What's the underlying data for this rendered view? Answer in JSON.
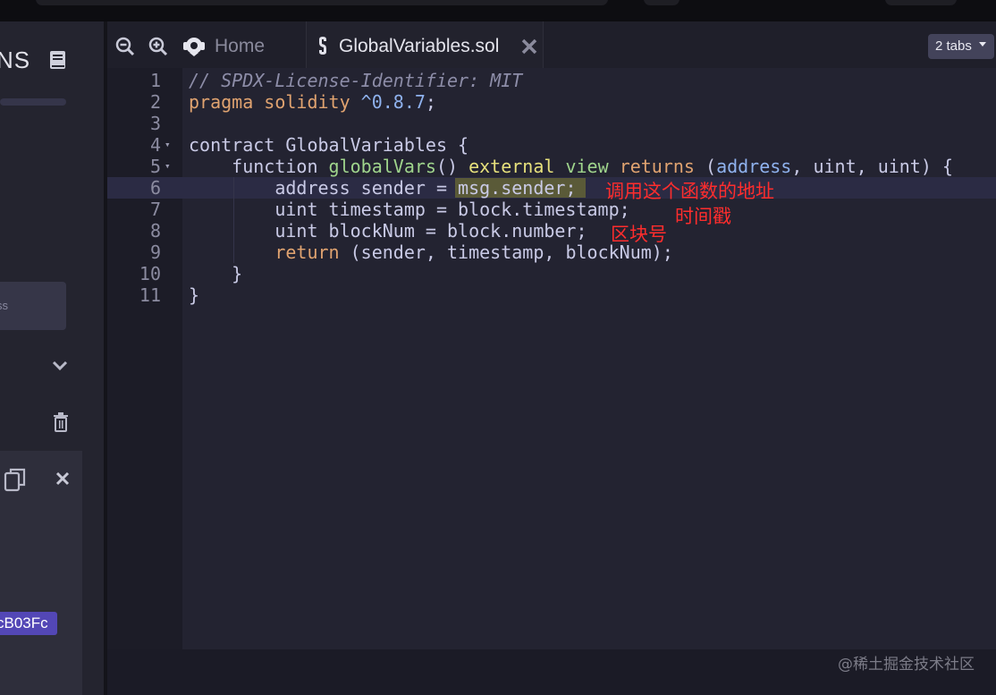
{
  "left_panel": {
    "title": "NS",
    "input_placeholder": "ss",
    "address_badge": "cB03Fc",
    "icons": [
      "book-icon",
      "chevron-down-icon",
      "trash-icon",
      "copy-icon",
      "close-icon"
    ]
  },
  "tabbar": {
    "home_label": "Home",
    "file_tab_label": "GlobalVariables.sol",
    "tabs_dropdown": "2 tabs",
    "icons": [
      "zoom-out-icon",
      "zoom-in-icon",
      "remix-logo-icon",
      "solidity-icon",
      "close-icon",
      "caret-down-icon"
    ]
  },
  "editor": {
    "lines": [
      {
        "n": "1",
        "fold": "",
        "tokens": [
          {
            "t": "// SPDX-License-Identifier: MIT",
            "c": "#8d8da8",
            "i": true
          }
        ]
      },
      {
        "n": "2",
        "fold": "",
        "tokens": [
          {
            "t": "pragma solidity ",
            "c": "#e0a370"
          },
          {
            "t": "^0.8.7",
            "c": "#8fb2ee"
          },
          {
            "t": ";",
            "c": "#c9cae6"
          }
        ]
      },
      {
        "n": "3",
        "fold": "",
        "tokens": []
      },
      {
        "n": "4",
        "fold": "▾",
        "tokens": [
          {
            "t": "contract GlobalVariables {",
            "c": "#c9cae6"
          }
        ]
      },
      {
        "n": "5",
        "fold": "▾",
        "tokens": [
          {
            "t": "    function ",
            "c": "#c9cae6"
          },
          {
            "t": "globalVars",
            "c": "#9fd48c"
          },
          {
            "t": "() ",
            "c": "#c9cae6"
          },
          {
            "t": "external ",
            "c": "#e6e07c"
          },
          {
            "t": "view ",
            "c": "#9fd48c"
          },
          {
            "t": "returns ",
            "c": "#e0a370"
          },
          {
            "t": "(",
            "c": "#c9cae6"
          },
          {
            "t": "address",
            "c": "#8fb2ee"
          },
          {
            "t": ", uint, uint) {",
            "c": "#c9cae6"
          }
        ]
      },
      {
        "n": "6",
        "fold": "",
        "tokens": [
          {
            "t": "        address sender = ",
            "c": "#c9cae6"
          },
          {
            "t": "msg.sender;",
            "c": "#c9cae6"
          }
        ]
      },
      {
        "n": "7",
        "fold": "",
        "tokens": [
          {
            "t": "        uint timestamp = block.timestamp;",
            "c": "#c9cae6"
          }
        ]
      },
      {
        "n": "8",
        "fold": "",
        "tokens": [
          {
            "t": "        uint blockNum = block.number;",
            "c": "#c9cae6"
          }
        ]
      },
      {
        "n": "9",
        "fold": "",
        "tokens": [
          {
            "t": "        ",
            "c": "#c9cae6"
          },
          {
            "t": "return ",
            "c": "#e0a370"
          },
          {
            "t": "(sender, timestamp, blockNum);",
            "c": "#c9cae6"
          }
        ]
      },
      {
        "n": "10",
        "fold": "",
        "tokens": [
          {
            "t": "    }",
            "c": "#c9cae6"
          }
        ]
      },
      {
        "n": "11",
        "fold": "",
        "tokens": [
          {
            "t": "}",
            "c": "#c9cae6"
          }
        ]
      }
    ]
  },
  "annotations": {
    "caller_address": "调用这个函数的地址",
    "timestamp": "时间戳",
    "block_number": "区块号"
  },
  "watermark": "@稀土掘金技术社区"
}
